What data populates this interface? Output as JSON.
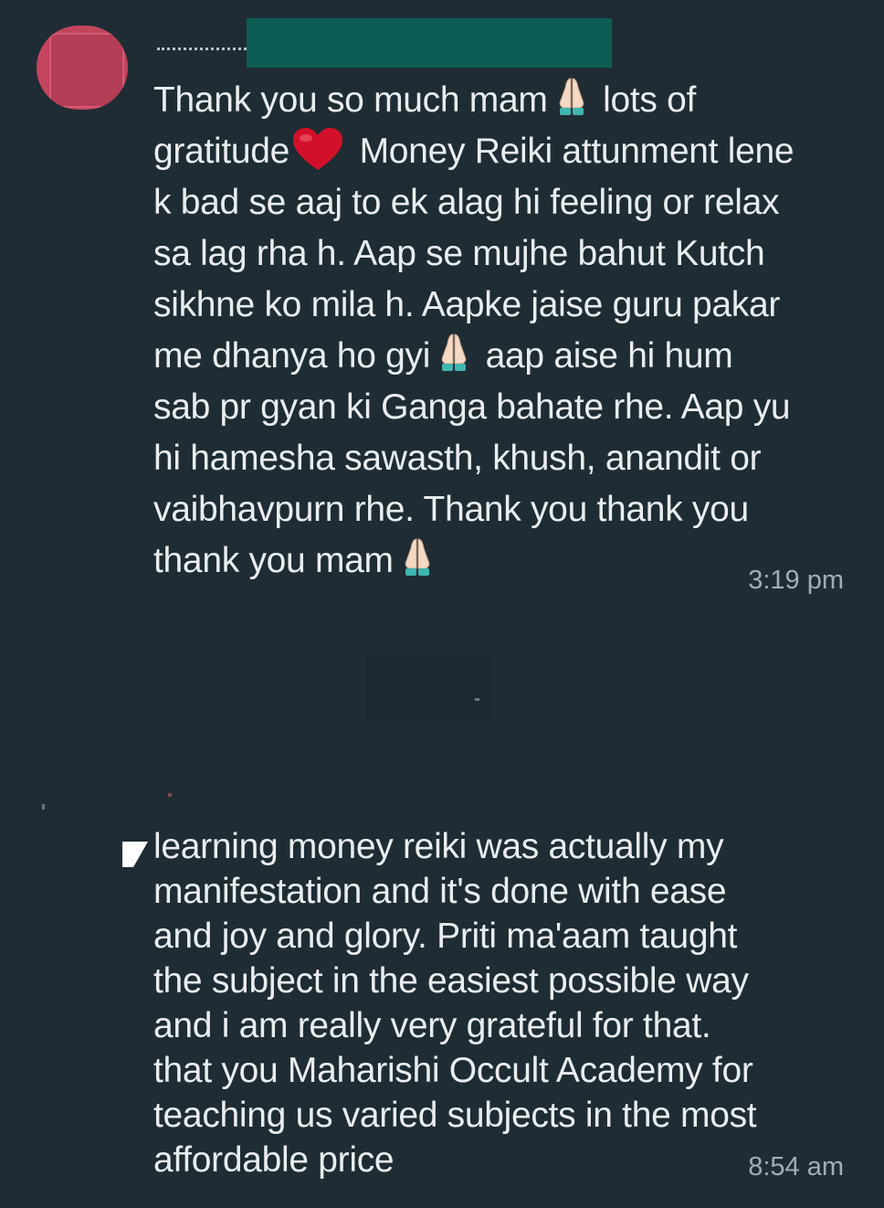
{
  "messages": [
    {
      "lines": [
        [
          "Thank you so much mam",
          "pray-emoji",
          " lots of"
        ],
        [
          "gratitude",
          "heart-emoji",
          " Money Reiki attunment lene"
        ],
        [
          "k bad se aaj to ek alag hi feeling or relax"
        ],
        [
          "sa lag rha h. Aap se mujhe bahut Kutch"
        ],
        [
          "sikhne ko mila h. Aapke jaise guru pakar"
        ],
        [
          "me dhanya ho gyi",
          "pray-emoji",
          " aap aise hi hum"
        ],
        [
          "sab pr gyan ki Ganga bahate rhe. Aap yu"
        ],
        [
          "hi hamesha sawasth, khush, anandit or"
        ],
        [
          "vaibhavpurn rhe. Thank you thank you"
        ],
        [
          "thank you mam",
          "pray-emoji"
        ]
      ],
      "time": "3:19 pm"
    },
    {
      "lines": [
        [
          "learning money reiki was actually my"
        ],
        [
          "manifestation and it's done with ease"
        ],
        [
          "and joy and glory. Priti ma'aam taught"
        ],
        [
          "the subject in the easiest possible way"
        ],
        [
          "and i am really very grateful for that."
        ],
        [
          "that you Maharishi Occult Academy for"
        ],
        [
          "teaching us varied subjects in the most"
        ],
        [
          "affordable price"
        ]
      ],
      "time": "8:54 am"
    }
  ],
  "colors": {
    "background": "#1f2c34",
    "text": "#e9edef",
    "timestamp": "#a0aeb5",
    "redaction": "#0c5e55",
    "avatar": "#c2455d"
  },
  "icons": [
    "pray-emoji",
    "heart-emoji",
    "avatar",
    "bubble-tail-icon"
  ]
}
